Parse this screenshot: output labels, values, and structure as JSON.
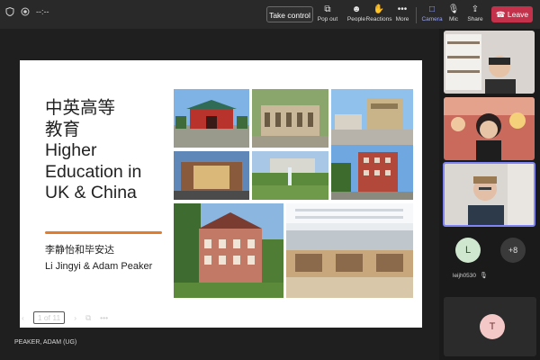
{
  "toolbar": {
    "timer": "--:--",
    "take_control": "Take control",
    "pop_out": "Pop out",
    "people": "People",
    "reactions": "Reactions",
    "more": "More",
    "camera": "Camera",
    "mic": "Mic",
    "share": "Share",
    "leave": "Leave",
    "accent": "#9aa6ff",
    "leave_color": "#c4314b"
  },
  "slide": {
    "title_lines": [
      "中英高等",
      "教育",
      "Higher",
      "Education in",
      "UK & China"
    ],
    "names_cn": "李静怡和毕安达",
    "names_en": "Li Jingyi & Adam Peaker"
  },
  "slide_controls": {
    "page_indicator": "1 of 11"
  },
  "presenter": "PEAKER, ADAM (UG)",
  "participants": {
    "l_initial": "L",
    "l_name": "leijh0530",
    "overflow": "+8",
    "t_initial": "T"
  }
}
